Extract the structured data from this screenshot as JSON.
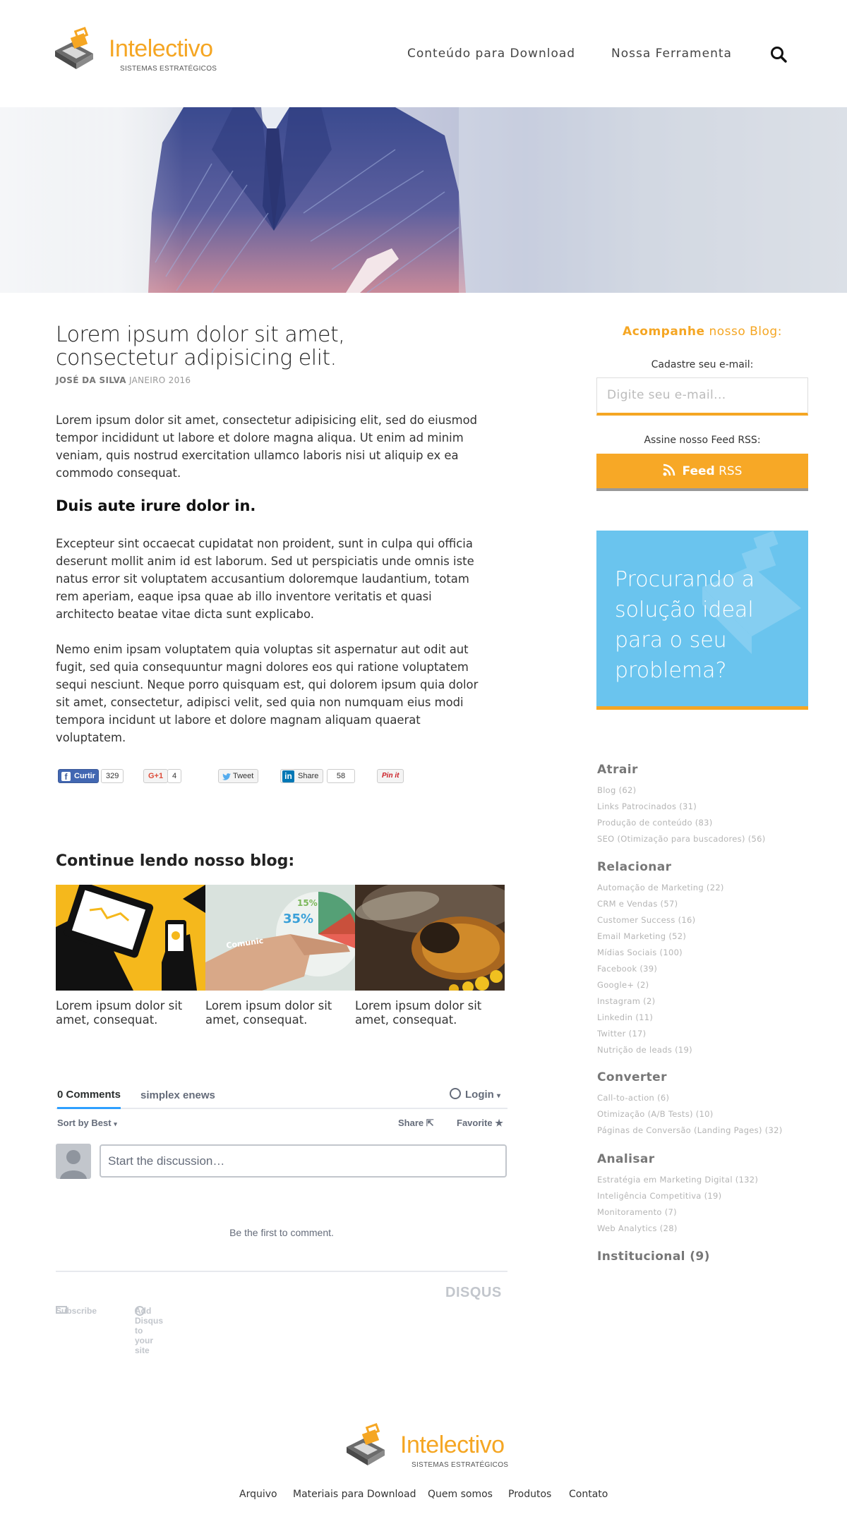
{
  "header": {
    "logo_name": "Intelectivo",
    "logo_tagline": "SISTEMAS ESTRATÉGICOS",
    "nav": [
      "Conteúdo para Download",
      "Nossa Ferramenta"
    ]
  },
  "article": {
    "title": "Lorem ipsum dolor sit amet, consectetur adipisicing elit.",
    "author": "JOSÉ DA SILVA",
    "date": "JANEIRO 2016",
    "paragraph1": "Lorem ipsum dolor sit amet, consectetur adipisicing elit, sed do eiusmod tempor incididunt ut labore et dolore magna aliqua. Ut enim ad minim veniam, quis nostrud exercitation ullamco laboris nisi ut aliquip ex ea commodo consequat.",
    "subheading": "Duis aute irure dolor in.",
    "paragraph2": "Excepteur sint occaecat cupidatat non proident, sunt in culpa qui officia deserunt mollit anim id est laborum. Sed ut perspiciatis unde omnis iste natus error sit voluptatem accusantium doloremque laudantium, totam rem aperiam, eaque ipsa quae ab illo inventore veritatis et quasi architecto beatae vitae dicta sunt explicabo.",
    "paragraph3": "Nemo enim ipsam voluptatem quia voluptas sit aspernatur aut odit aut fugit, sed quia consequuntur magni dolores eos qui ratione voluptatem sequi nesciunt. Neque porro quisquam est, qui dolorem ipsum quia dolor sit amet, consectetur, adipisci velit, sed quia non numquam eius modi tempora incidunt ut labore et dolore magnam aliquam quaerat voluptatem."
  },
  "social": {
    "facebook": {
      "label": "Curtir",
      "count": "329"
    },
    "gplus": {
      "label": "G+1",
      "count": "4"
    },
    "twitter": {
      "label": "Tweet"
    },
    "linkedin": {
      "label": "Share",
      "count": "58"
    },
    "pinterest": {
      "label": "Pin it"
    }
  },
  "continue": {
    "title": "Continue lendo nosso blog:",
    "posts": [
      {
        "caption": "Lorem ipsum dolor sit amet, consequat."
      },
      {
        "caption": "Lorem ipsum dolor sit amet, consequat."
      },
      {
        "caption": "Lorem ipsum dolor sit amet, consequat."
      }
    ],
    "thumb2_text": "Comunic"
  },
  "disqus": {
    "tab_comments": "0 Comments",
    "tab_site": "simplex enews",
    "login": "Login",
    "sort": "Sort by Best",
    "share": "Share",
    "favorite": "Favorite",
    "input_placeholder": "Start the discussion…",
    "empty": "Be the first to comment.",
    "subscribe": "Subscribe",
    "add": "Add Disqus to your site",
    "brand": "DISQUS"
  },
  "sidebar": {
    "follow_bold": "Acompanhe",
    "follow_rest": " nosso Blog:",
    "email_label": "Cadastre seu e-mail:",
    "email_placeholder": "Digite seu e-mail...",
    "rss_label": "Assine nosso Feed RSS:",
    "rss_bold": "Feed",
    "rss_rest": " RSS",
    "promo": "Procurando a solução ideal para o seu problema?",
    "categories": [
      {
        "head": "Atrair",
        "items": [
          "Blog (62)",
          "Links Patrocinados (31)",
          "Produção de conteúdo (83)",
          "SEO (Otimização para buscadores) (56)"
        ]
      },
      {
        "head": "Relacionar",
        "items": [
          "Automação de Marketing (22)",
          "CRM e Vendas (57)",
          "Customer Success (16)",
          "Email Marketing (52)",
          "Mídias Sociais (100)",
          "Facebook (39)",
          "Google+ (2)",
          "Instagram (2)",
          "Linkedin (11)",
          "Twitter (17)",
          "Nutrição de leads (19)"
        ]
      },
      {
        "head": "Converter",
        "items": [
          "Call-to-action (6)",
          "Otimização (A/B Tests) (10)",
          "Páginas de Conversão (Landing Pages) (32)"
        ]
      },
      {
        "head": "Analisar",
        "items": [
          "Estratégia em Marketing Digital (132)",
          "Inteligência Competitiva (19)",
          "Monitoramento (7)",
          "Web Analytics (28)"
        ]
      },
      {
        "head": "Institucional (9)",
        "items": []
      }
    ]
  },
  "footer": {
    "nav": [
      "Arquivo",
      "Materiais para Download",
      "Quem somos",
      "Produtos",
      "Contato"
    ]
  },
  "colors": {
    "accent": "#f5a623",
    "promo": "#6ac4ee"
  }
}
